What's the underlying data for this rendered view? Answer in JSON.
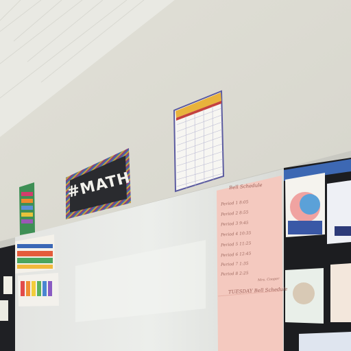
{
  "scene": {
    "banner_text": "#MATH",
    "schedule_title": "Bell Schedule",
    "schedule_lines": [
      "Period 1  8:05",
      "Period 2  8:55",
      "Period 3  9:45",
      "Period 4  10:35",
      "Period 5  11:25",
      "Period 6  12:45",
      "Period 7  1:35",
      "Period 8  2:25"
    ],
    "schedule_signature": "Mrs. Cooper",
    "schedule_title_2": "TUESDAY Bell Schedule",
    "colors": {
      "wall": "#e4e3db",
      "ceiling": "#e9e9e3",
      "whiteboard": "#dedfdb",
      "pink_paper": "#f4c9bf",
      "bulletin_board": "#1c1d20"
    }
  }
}
